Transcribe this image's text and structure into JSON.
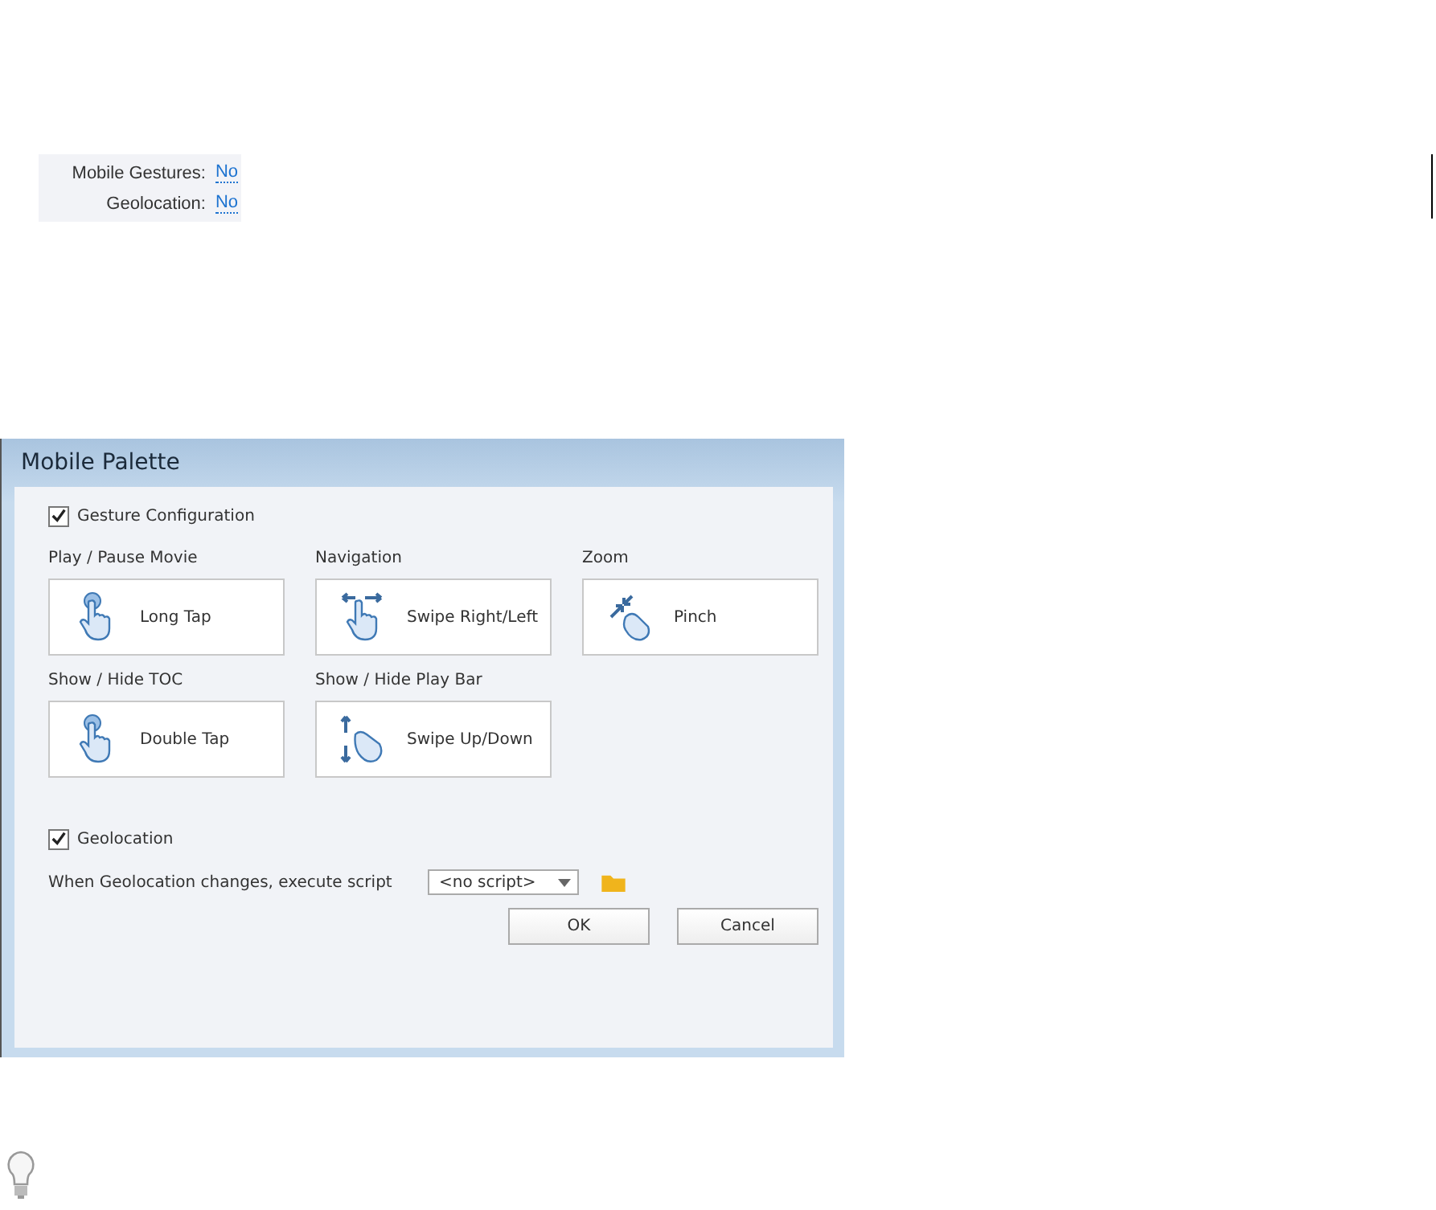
{
  "summary": [
    {
      "label": "Mobile Gestures:",
      "value": "No"
    },
    {
      "label": "Geolocation:",
      "value": "No"
    }
  ],
  "dialog": {
    "title": "Mobile Palette",
    "gesture_configuration": {
      "label": "Gesture Configuration",
      "checked": true
    },
    "gestures": [
      {
        "label": "Play / Pause Movie",
        "gesture": "Long Tap",
        "kind": "tap"
      },
      {
        "label": "Navigation",
        "gesture": "Swipe Right/Left",
        "kind": "swipe-horizontal"
      },
      {
        "label": "Zoom",
        "gesture": "Pinch",
        "kind": "pinch"
      },
      {
        "label": "Show / Hide TOC",
        "gesture": "Double Tap",
        "kind": "tap"
      },
      {
        "label": "Show / Hide Play Bar",
        "gesture": "Swipe Up/Down",
        "kind": "swipe-vertical"
      }
    ],
    "geolocation": {
      "label": "Geolocation",
      "checked": true
    },
    "script_label": "When Geolocation changes, execute script",
    "script_select": "<no script>",
    "buttons": [
      "OK",
      "Cancel"
    ]
  }
}
